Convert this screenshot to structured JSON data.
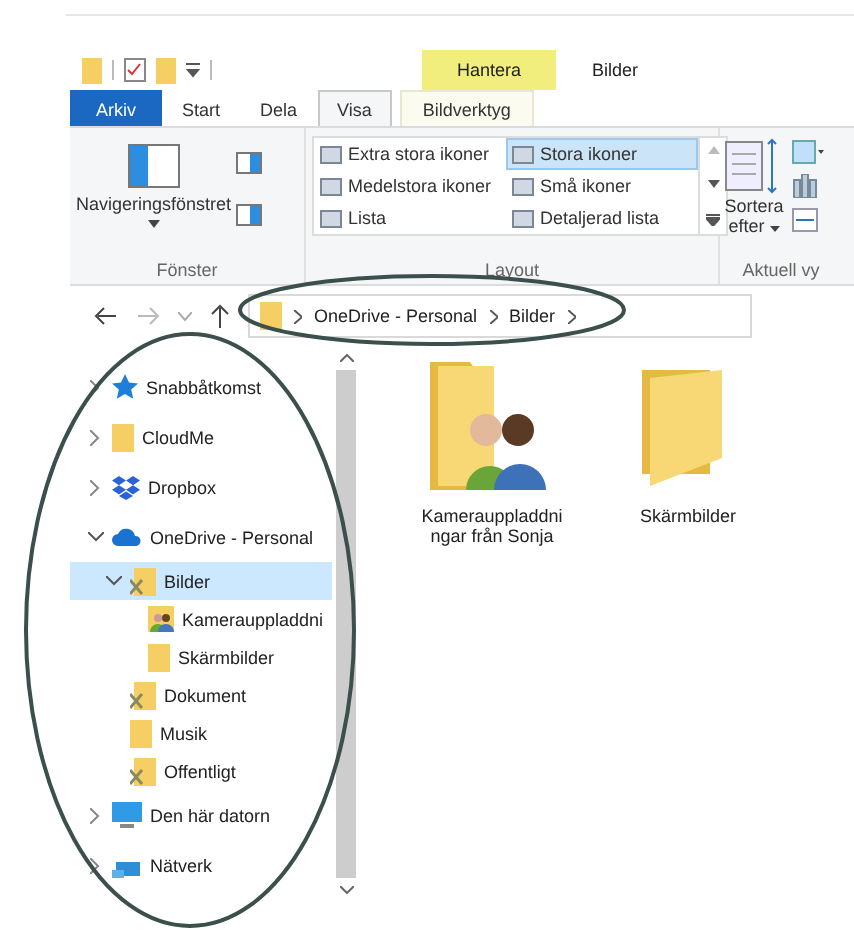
{
  "window": {
    "context_tab": "Hantera",
    "title": "Bilder"
  },
  "tabs": [
    {
      "label": "Arkiv",
      "kind": "file",
      "selected": false
    },
    {
      "label": "Start",
      "kind": "normal",
      "selected": false
    },
    {
      "label": "Dela",
      "kind": "normal",
      "selected": false
    },
    {
      "label": "Visa",
      "kind": "normal",
      "selected": true
    },
    {
      "label": "Bildverktyg",
      "kind": "context",
      "selected": false
    }
  ],
  "ribbon": {
    "navigation_pane": "Navigeringsfönstret",
    "group_windows": "Fönster",
    "layout_options": [
      {
        "label": "Extra stora ikoner",
        "selected": false
      },
      {
        "label": "Stora ikoner",
        "selected": true
      },
      {
        "label": "Medelstora ikoner",
        "selected": false
      },
      {
        "label": "Små ikoner",
        "selected": false
      },
      {
        "label": "Lista",
        "selected": false
      },
      {
        "label": "Detaljerad lista",
        "selected": false
      }
    ],
    "group_layout": "Layout",
    "sort_label_1": "Sortera",
    "sort_label_2": "efter",
    "group_view": "Aktuell vy"
  },
  "address": {
    "segments": [
      "OneDrive - Personal",
      "Bilder"
    ]
  },
  "nav_tree": [
    {
      "label": "Snabbåtkomst",
      "kind": "star",
      "expanded": false,
      "selected": false
    },
    {
      "label": "CloudMe",
      "kind": "folder",
      "expanded": false,
      "selected": false
    },
    {
      "label": "Dropbox",
      "kind": "dropbox",
      "expanded": false,
      "selected": false
    },
    {
      "label": "OneDrive - Personal",
      "kind": "cloud",
      "expanded": true,
      "selected": false,
      "children": [
        {
          "label": "Bilder",
          "kind": "shared",
          "expanded": true,
          "selected": true,
          "children": [
            {
              "label": "Kamerauppladdni",
              "kind": "people",
              "selected": false
            },
            {
              "label": "Skärmbilder",
              "kind": "folder",
              "selected": false
            }
          ]
        },
        {
          "label": "Dokument",
          "kind": "shared",
          "selected": false
        },
        {
          "label": "Musik",
          "kind": "folder",
          "selected": false
        },
        {
          "label": "Offentligt",
          "kind": "shared",
          "selected": false
        }
      ]
    },
    {
      "label": "Den här datorn",
      "kind": "pc",
      "expanded": false,
      "selected": false
    },
    {
      "label": "Nätverk",
      "kind": "network",
      "expanded": false,
      "selected": false
    }
  ],
  "files": [
    {
      "label": "Kamerauppladdningar från Sonja",
      "kind": "people"
    },
    {
      "label": "Skärmbilder",
      "kind": "folder"
    }
  ]
}
